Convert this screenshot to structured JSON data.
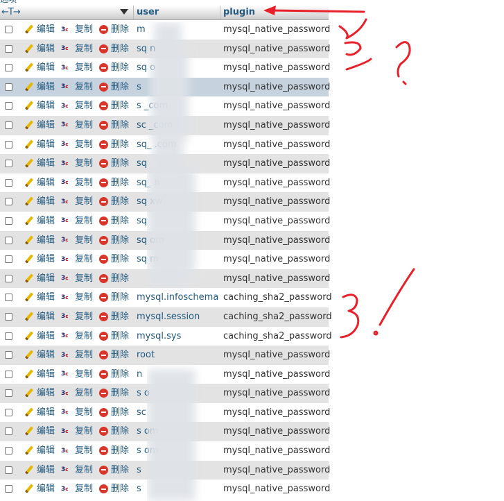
{
  "top_label": "选项",
  "header": {
    "arrows": "←T→",
    "user_col": "user",
    "plugin_col": "plugin"
  },
  "actions": {
    "edit": "编辑",
    "copy": "复制",
    "delete": "删除",
    "edit_icon": "pencil-icon",
    "copy_icon": "copy-icon",
    "delete_icon": "delete-icon"
  },
  "rows": [
    {
      "user": "m",
      "plugin": "mysql_native_password"
    },
    {
      "user": "sq            n",
      "plugin": "mysql_native_password"
    },
    {
      "user": "sq            o",
      "plugin": "mysql_native_password"
    },
    {
      "user": "s",
      "plugin": "mysql_native_password"
    },
    {
      "user": "s             _com",
      "plugin": "mysql_native_password"
    },
    {
      "user": "sc            _com",
      "plugin": "mysql_native_password"
    },
    {
      "user": "sq_          .com",
      "plugin": "mysql_native_password"
    },
    {
      "user": "sq",
      "plugin": "mysql_native_password"
    },
    {
      "user": "sq_          n",
      "plugin": "mysql_native_password"
    },
    {
      "user": "sq            xw",
      "plugin": "mysql_native_password"
    },
    {
      "user": "sq",
      "plugin": "mysql_native_password"
    },
    {
      "user": "sq             om",
      "plugin": "mysql_native_password"
    },
    {
      "user": "sq              m",
      "plugin": "mysql_native_password"
    },
    {
      "user": "",
      "plugin": "mysql_native_password"
    },
    {
      "user": "mysql.infoschema",
      "plugin": "caching_sha2_password"
    },
    {
      "user": "mysql.session",
      "plugin": "caching_sha2_password"
    },
    {
      "user": "mysql.sys",
      "plugin": "caching_sha2_password"
    },
    {
      "user": "root",
      "plugin": "mysql_native_password"
    },
    {
      "user": "            n",
      "plugin": "mysql_native_password"
    },
    {
      "user": "s            o",
      "plugin": "mysql_native_password"
    },
    {
      "user": "sc",
      "plugin": "mysql_native_password"
    },
    {
      "user": "s             om",
      "plugin": "mysql_native_password"
    },
    {
      "user": "s              om",
      "plugin": "mysql_native_password"
    },
    {
      "user": "s",
      "plugin": "mysql_native_password"
    },
    {
      "user": "s",
      "plugin": "mysql_native_password"
    }
  ],
  "highlight_row": 3,
  "annotations": {
    "color": "#e8202a",
    "marks": [
      "1",
      "2?",
      "3!"
    ]
  },
  "colors": {
    "link": "#235a81",
    "row_alt": "#e3e3e3",
    "row_highlight": "#c6d2de"
  }
}
